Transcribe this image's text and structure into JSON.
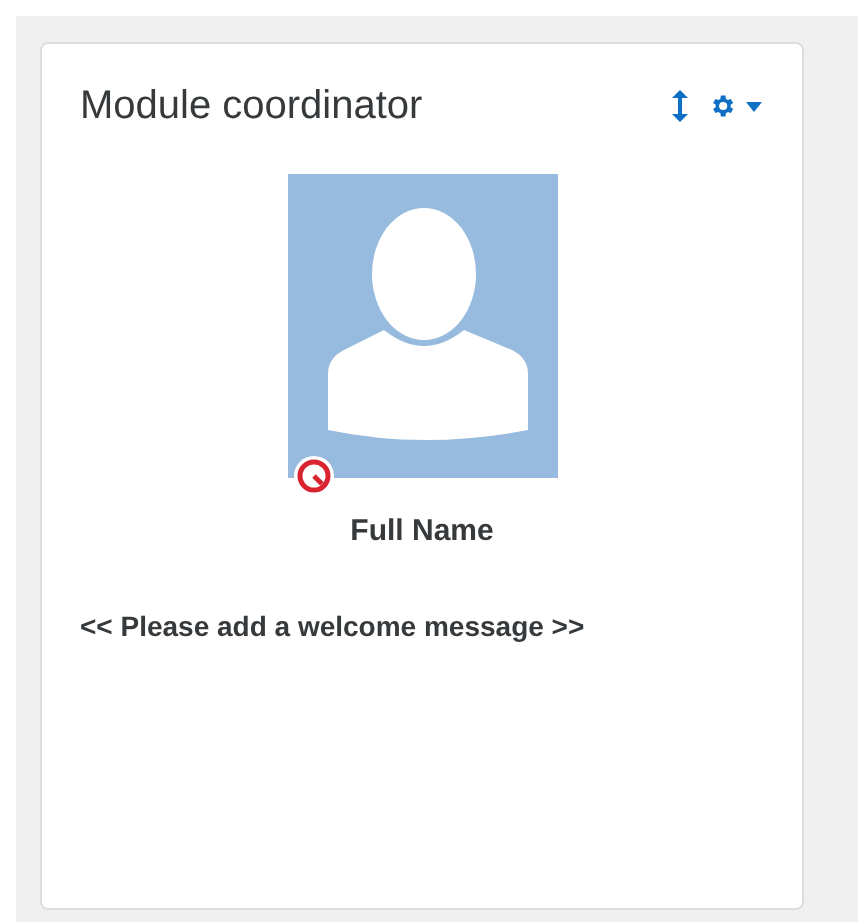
{
  "block": {
    "title": "Module coordinator",
    "name": "Full Name",
    "message": "<< Please add a welcome message >>"
  }
}
